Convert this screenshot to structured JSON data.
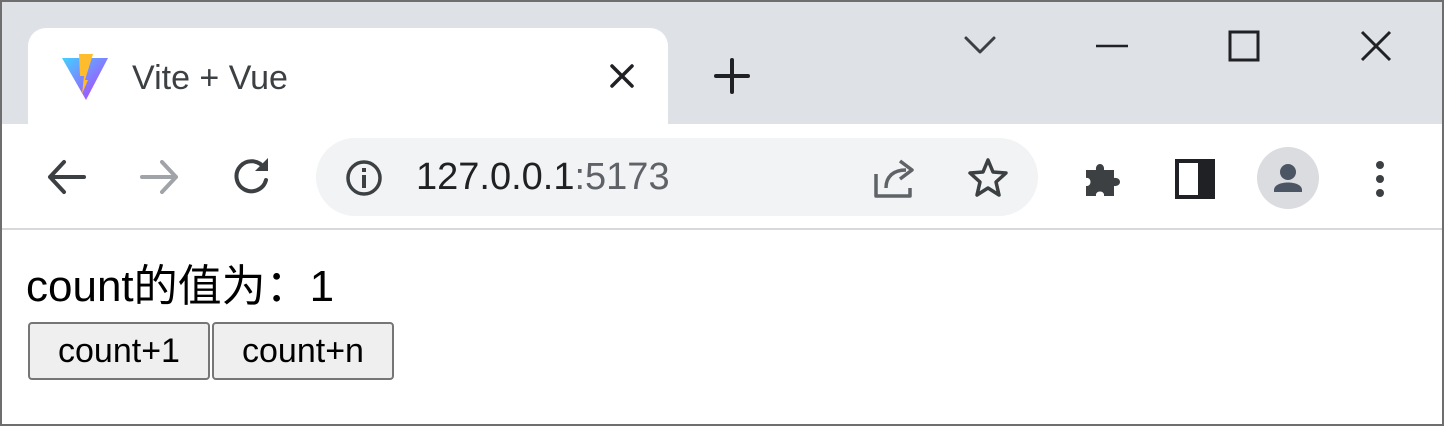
{
  "tab": {
    "title": "Vite + Vue",
    "favicon": "vite-logo-icon"
  },
  "address_bar": {
    "host": "127.0.0.1",
    "port": ":5173"
  },
  "page": {
    "count_label": "count的值为：1",
    "buttons": [
      {
        "label": "count+1"
      },
      {
        "label": "count+n"
      }
    ]
  },
  "colors": {
    "title_bar": "#dee1e6",
    "omnibox": "#f1f3f4",
    "icon": "#5f6368",
    "vite_purple": "#bd34fe",
    "vite_blue": "#41d1ff",
    "vite_yellow": "#ffbd2e",
    "avatar_bg": "#dadce0",
    "avatar_fg": "#4b5563"
  }
}
